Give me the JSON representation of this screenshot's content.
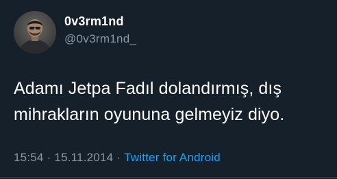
{
  "tweet": {
    "author": {
      "display_name": "0v3rm1nd",
      "handle": "@0v3rm1nd_",
      "avatar_icon": "user-avatar-photo"
    },
    "text_lines": [
      "Adamı Jetpa Fadıl dolandırmış, dış",
      "mihrakların oyununa gelmeyiz diyo."
    ],
    "time": "15:54",
    "separator": "·",
    "date": "15.11.2014",
    "source": "Twitter for Android",
    "colors": {
      "background": "#15202b",
      "primary_text": "#ffffff",
      "secondary_text": "#8899a6",
      "link": "#1da1f2"
    }
  }
}
